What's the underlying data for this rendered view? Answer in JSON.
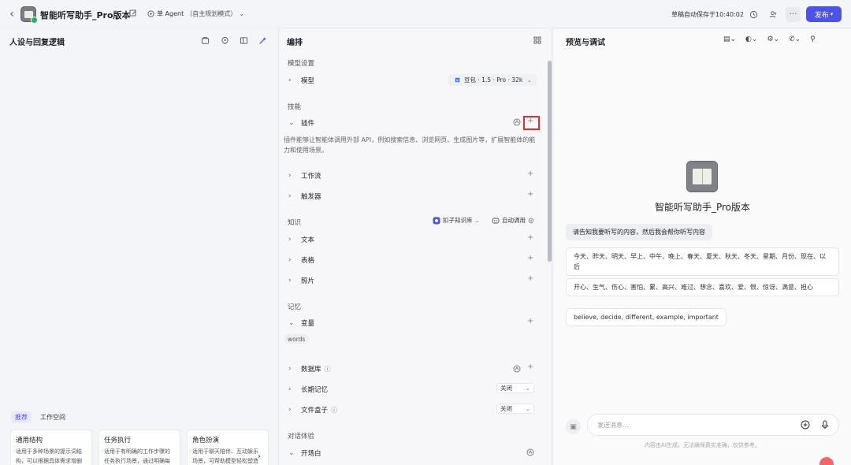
{
  "header": {
    "app_title": "智能听写助手_Pro版本",
    "mode_label": "单 Agent",
    "mode_sub": "（自主规划模式）",
    "save_status": "草稿自动保存于10:40:02",
    "publish_label": "发布"
  },
  "left": {
    "title": "人设与回复逻辑",
    "tabs": [
      "推荐",
      "工作空间"
    ],
    "cards": [
      {
        "title": "通用结构",
        "desc": "适用于多种场景的提示词结构，可以根据具体需求增删对应模块"
      },
      {
        "title": "任务执行",
        "desc": "适用于有明确的工作步骤的任务执行场景，通过明确每一步骤的工作要求..."
      },
      {
        "title": "角色扮演",
        "desc": "适用于聊天陪伴、互动娱乐场景，可帮助模型轻松塑造个性化的人物角色..."
      }
    ]
  },
  "mid": {
    "title": "编排",
    "model_section": "模型设置",
    "model_label": "模型",
    "model_value": "豆包 · 1.5 · Pro · 32k",
    "skills_section": "技能",
    "plugin_label": "插件",
    "plugin_desc": "插件能够让智能体调用外部 API，例如搜索信息、浏览网页、生成图片等，扩展智能体的能力和使用场景。",
    "workflow_label": "工作流",
    "trigger_label": "触发器",
    "knowledge_section": "知识",
    "kb_label": "扣子知识库",
    "auto_call_label": "自动调用",
    "text_label": "文本",
    "table_label": "表格",
    "photo_label": "照片",
    "memory_section": "记忆",
    "variable_label": "变量",
    "variable_tag": "words",
    "database_label": "数据库",
    "longterm_label": "长期记忆",
    "longterm_value": "关闭",
    "filebox_label": "文件盒子",
    "filebox_value": "关闭",
    "dialog_section": "对话体验",
    "opener_label": "开场白"
  },
  "right": {
    "title": "预览与调试",
    "bot_name": "智能听写助手_Pro版本",
    "greeting": "请告知我要听写的内容，然后我会帮你听写内容",
    "suggestions": [
      "今天、昨天、明天、早上、中午、晚上、春天、夏天、秋天、冬天、星期、月份、现在、以后",
      "开心、生气、伤心、害怕、累、高兴、难过、想念、喜欢、爱、恨、惊讶、满意、担心",
      "believe, decide, different, example, important"
    ],
    "input_placeholder": "发送消息...",
    "disclaimer": "内容由AI生成，无法确保真实准确，仅供参考。"
  }
}
